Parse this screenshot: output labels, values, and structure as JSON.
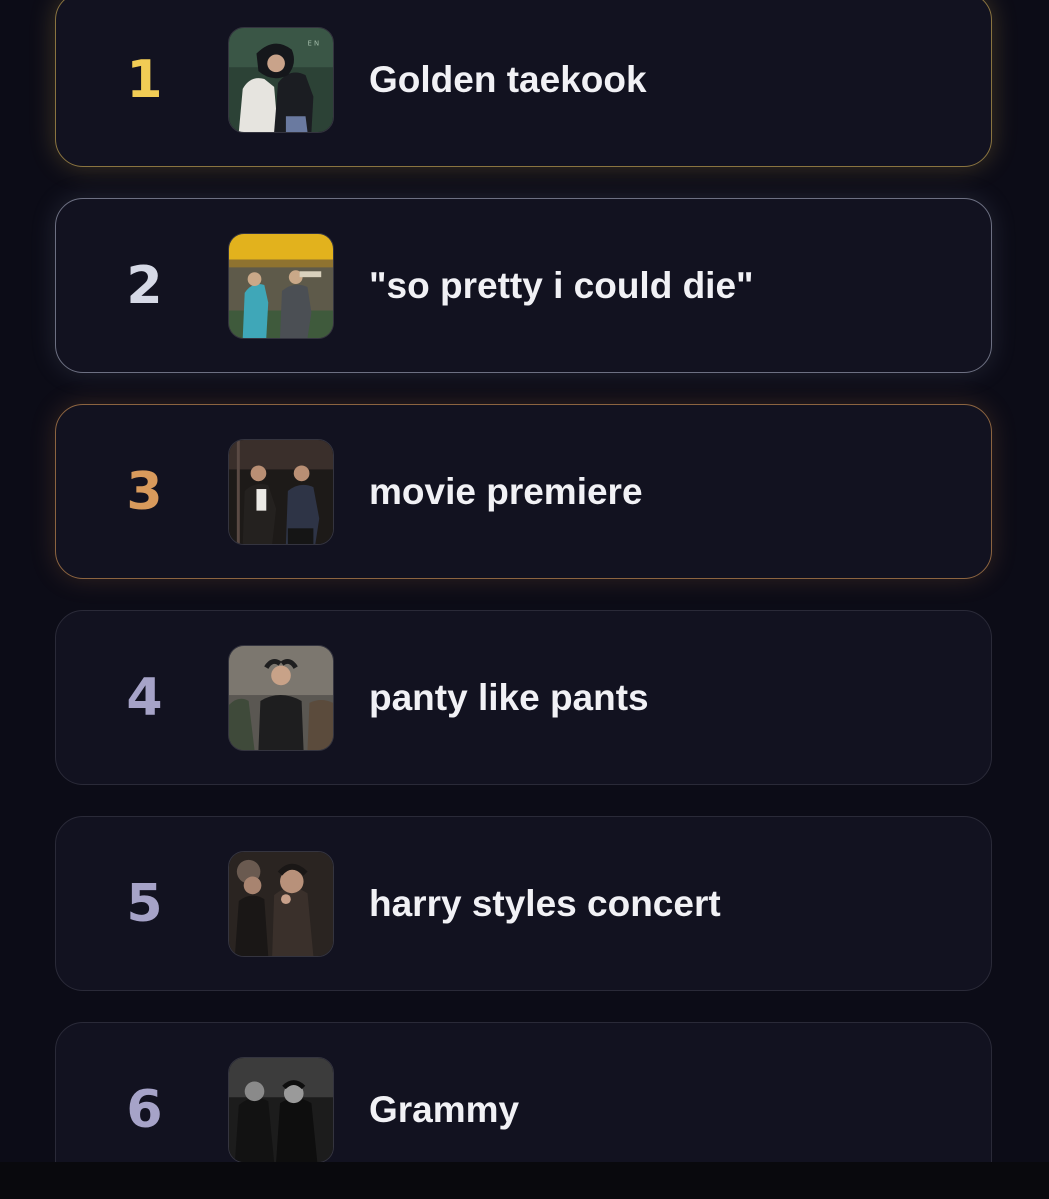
{
  "ranking": {
    "items": [
      {
        "rank": "1",
        "title": "Golden taekook",
        "rank_color": "#f1cc55",
        "tier": "gold"
      },
      {
        "rank": "2",
        "title": "\"so pretty i could die\"",
        "rank_color": "#d6d9e6",
        "tier": "silver"
      },
      {
        "rank": "3",
        "title": "movie premiere",
        "rank_color": "#d89a5c",
        "tier": "bronze"
      },
      {
        "rank": "4",
        "title": "panty like pants",
        "rank_color": "#a6a3c8",
        "tier": "regular"
      },
      {
        "rank": "5",
        "title": "harry styles concert",
        "rank_color": "#a6a3c8",
        "tier": "regular"
      },
      {
        "rank": "6",
        "title": "Grammy",
        "rank_color": "#a6a3c8",
        "tier": "regular"
      }
    ]
  }
}
